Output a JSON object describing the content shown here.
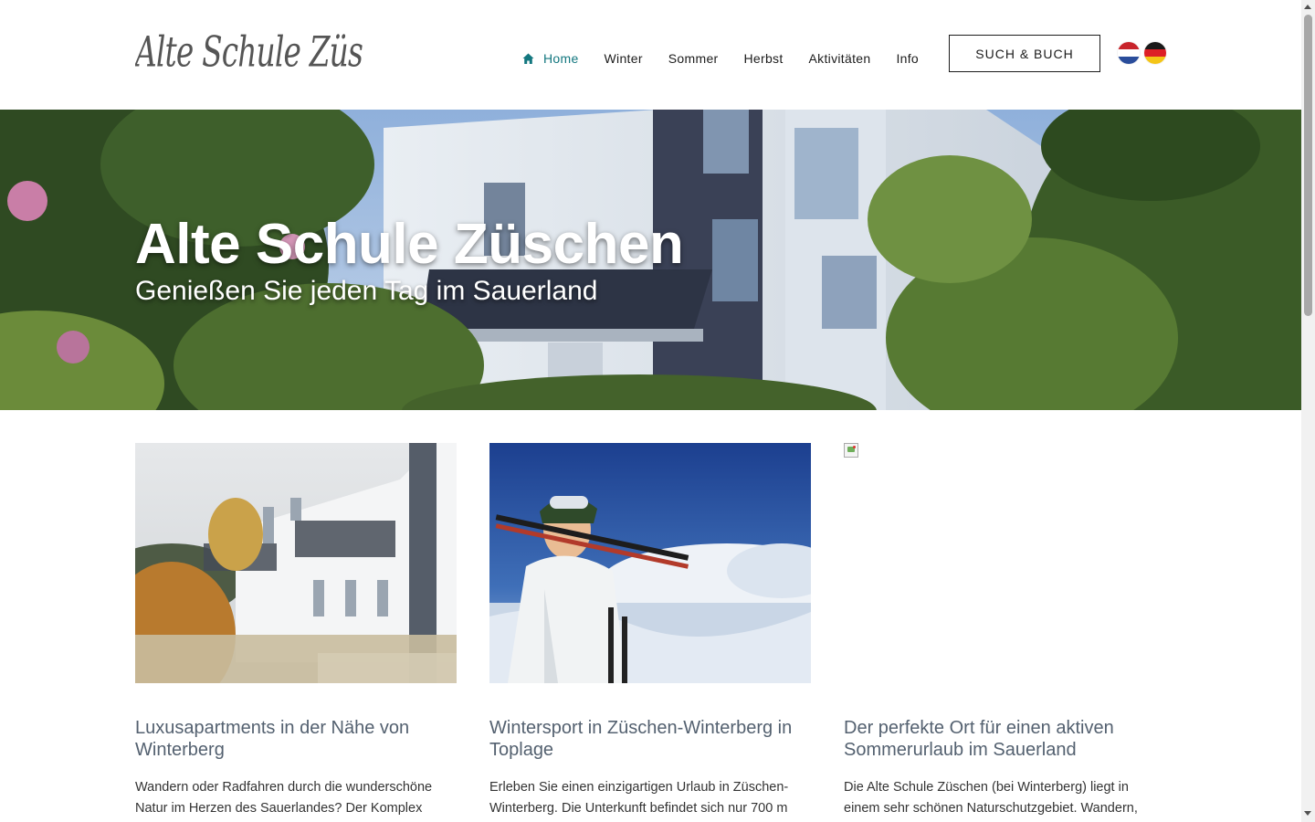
{
  "header": {
    "logo_text": "Alte Schule Züschen",
    "nav": [
      {
        "label": "Home",
        "active": true,
        "icon": "home-icon"
      },
      {
        "label": "Winter"
      },
      {
        "label": "Sommer"
      },
      {
        "label": "Herbst"
      },
      {
        "label": "Aktivitäten"
      },
      {
        "label": "Info"
      }
    ],
    "book_button": "SUCH & BUCH",
    "languages": [
      "nl-flag-icon",
      "de-flag-icon"
    ],
    "accent_color": "#13777f"
  },
  "hero": {
    "title": "Alte Schule Züschen",
    "subtitle": "Genießen Sie jeden Tag im Sauerland"
  },
  "cards": [
    {
      "title": "Luxusapartments in der Nähe von Winterberg",
      "text": "Wandern oder Radfahren durch die wunderschöne Natur im Herzen des Sauerlandes? Der Komplex"
    },
    {
      "title": "Wintersport in Züschen-Winterberg in Toplage",
      "text": "Erleben Sie einen einzigartigen Urlaub in Züschen-Winterberg. Die Unterkunft befindet sich nur 700 m"
    },
    {
      "title": "Der perfekte Ort für einen aktiven Sommerurlaub im Sauerland",
      "text": "Die Alte Schule Züschen (bei Winterberg) liegt in einem sehr schönen Naturschutzgebiet. Wandern,"
    }
  ],
  "colors": {
    "card_title": "#546170",
    "text": "#333333"
  }
}
